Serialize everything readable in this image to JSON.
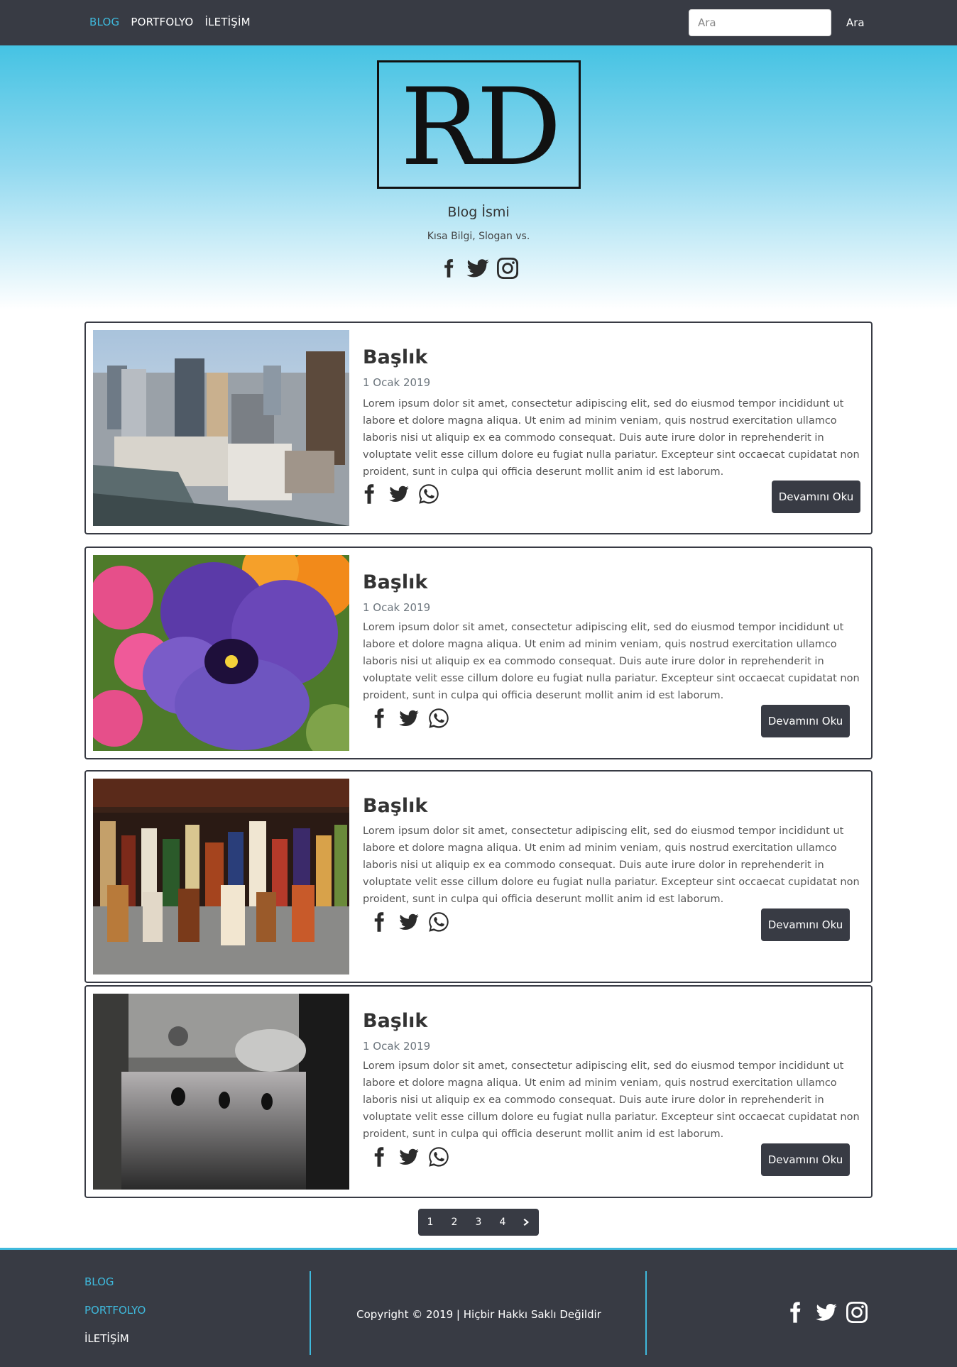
{
  "nav": {
    "links": [
      {
        "label": "BLOG",
        "active": true
      },
      {
        "label": "PORTFOLYO",
        "active": false
      },
      {
        "label": "İLETİŞİM",
        "active": false
      }
    ],
    "search": {
      "placeholder": "Ara",
      "button_label": "Ara"
    }
  },
  "header": {
    "logo": "RD",
    "blog_name": "Blog İsmi",
    "slogan": "Kısa Bilgi, Slogan vs.",
    "social_icons": [
      "facebook-icon",
      "twitter-icon",
      "instagram-icon"
    ]
  },
  "posts": [
    {
      "title": "Başlık",
      "date": "1 Ocak 2019",
      "text": "Lorem ipsum dolor sit amet, consectetur adipiscing elit, sed do eiusmod tempor incididunt ut labore et dolore magna aliqua. Ut enim ad minim veniam, quis nostrud exercitation ullamco laboris nisi ut aliquip ex ea commodo consequat. Duis aute irure dolor in reprehenderit in voluptate velit esse cillum dolore eu fugiat nulla pariatur. Excepteur sint occaecat cupidatat non proident, sunt in culpa qui officia deserunt mollit anim id est laborum.",
      "button": "Devamını Oku",
      "image": "city-skyline"
    },
    {
      "title": "Başlık",
      "date": "1 Ocak 2019",
      "text": "Lorem ipsum dolor sit amet, consectetur adipiscing elit, sed do eiusmod tempor incididunt ut labore et dolore magna aliqua. Ut enim ad minim veniam, quis nostrud exercitation ullamco laboris nisi ut aliquip ex ea commodo consequat. Duis aute irure dolor in reprehenderit in voluptate velit esse cillum dolore eu fugiat nulla pariatur. Excepteur sint occaecat cupidatat non proident, sunt in culpa qui officia deserunt mollit anim id est laborum.",
      "button": "Devamını Oku",
      "image": "pansy-flower"
    },
    {
      "title": "Başlık",
      "date": "",
      "text": "Lorem ipsum dolor sit amet, consectetur adipiscing elit, sed do eiusmod tempor incididunt ut labore et dolore magna aliqua. Ut enim ad minim veniam, quis nostrud exercitation ullamco laboris nisi ut aliquip ex ea commodo consequat. Duis aute irure dolor in reprehenderit in voluptate velit esse cillum dolore eu fugiat nulla pariatur. Excepteur sint occaecat cupidatat non proident, sunt in culpa qui officia deserunt mollit anim id est laborum.",
      "button": "Devamını Oku",
      "image": "bottles-shelf"
    },
    {
      "title": "Başlık",
      "date": "1 Ocak 2019",
      "text": "Lorem ipsum dolor sit amet, consectetur adipiscing elit, sed do eiusmod tempor incididunt ut labore et dolore magna aliqua. Ut enim ad minim veniam, quis nostrud exercitation ullamco laboris nisi ut aliquip ex ea commodo consequat. Duis aute irure dolor in reprehenderit in voluptate velit esse cillum dolore eu fugiat nulla pariatur. Excepteur sint occaecat cupidatat non proident, sunt in culpa qui officia deserunt mollit anim id est laborum.",
      "button": "Devamını Oku",
      "image": "cats-garage"
    }
  ],
  "pagination": {
    "pages": [
      "1",
      "2",
      "3",
      "4"
    ],
    "next_icon": "chevron-right-icon"
  },
  "footer": {
    "links": [
      {
        "label": "BLOG"
      },
      {
        "label": "PORTFOLYO"
      },
      {
        "label": "İLETİŞİM"
      }
    ],
    "copyright": "Copyright © 2019 | Hiçbir Hakkı Saklı Değildir",
    "social_icons": [
      "facebook-icon",
      "twitter-icon",
      "instagram-icon"
    ]
  },
  "colors": {
    "dark": "#383b44",
    "accent": "#3fb9dc",
    "hero_top": "#45c3e3"
  }
}
